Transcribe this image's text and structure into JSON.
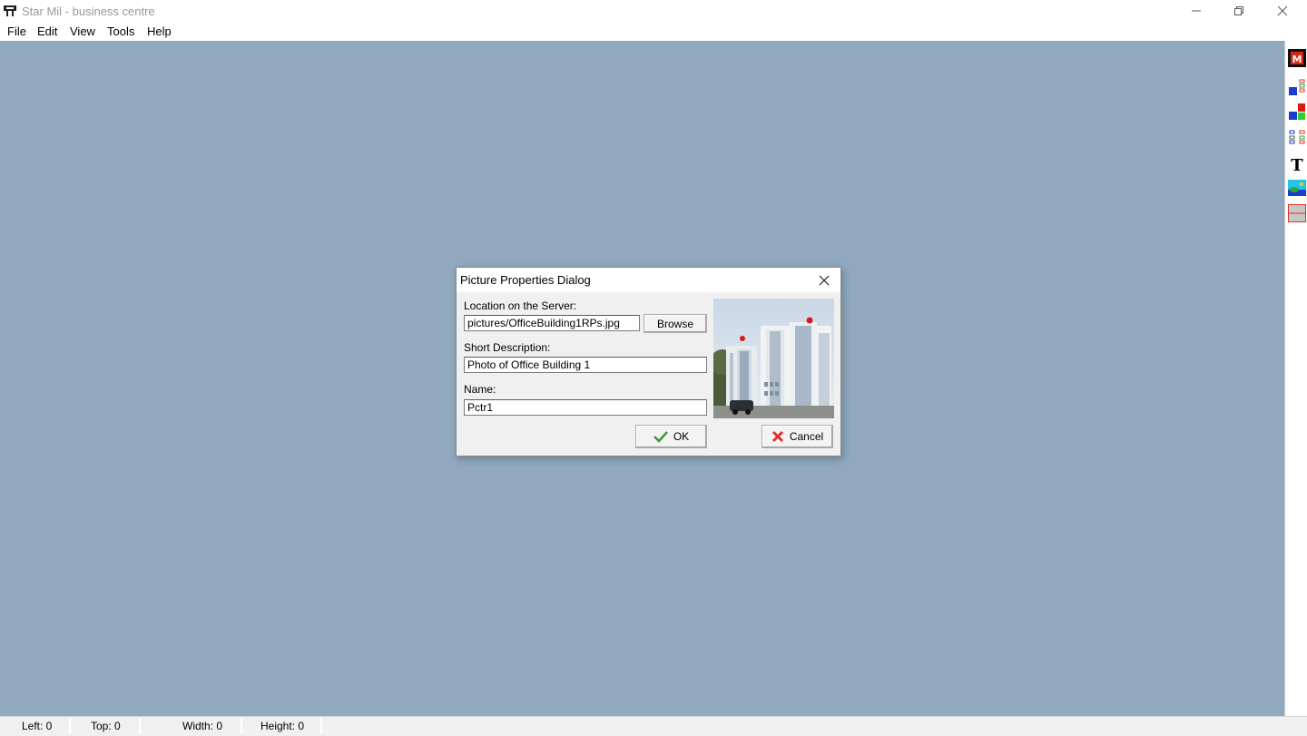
{
  "window": {
    "title": "Star Mil - business centre"
  },
  "menu": {
    "items": [
      {
        "label": "File"
      },
      {
        "label": "Edit"
      },
      {
        "label": "View"
      },
      {
        "label": "Tools"
      },
      {
        "label": "Help"
      }
    ]
  },
  "toolbar": {
    "tools": [
      "logo-icon",
      "list-layout-icon",
      "color-blocks-icon",
      "grid-layout-icon",
      "text-tool-icon",
      "picture-tool-icon",
      "frame-tool-icon"
    ]
  },
  "status": {
    "left": "Left: 0",
    "top": "Top: 0",
    "width": "Width: 0",
    "height": "Height: 0"
  },
  "dialog": {
    "title": "Picture Properties Dialog",
    "location_label": "Location on the Server:",
    "location_value": "pictures/OfficeBuilding1RPs.jpg",
    "browse_label": "Browse",
    "description_label": "Short Description:",
    "description_value": "Photo of Office Building 1",
    "name_label": "Name:",
    "name_value": "Pctr1",
    "ok_label": "OK",
    "cancel_label": "Cancel"
  },
  "colors": {
    "canvas": "#90a9bf",
    "ok_check": "#3a9a3a",
    "cancel_x": "#e03030"
  }
}
